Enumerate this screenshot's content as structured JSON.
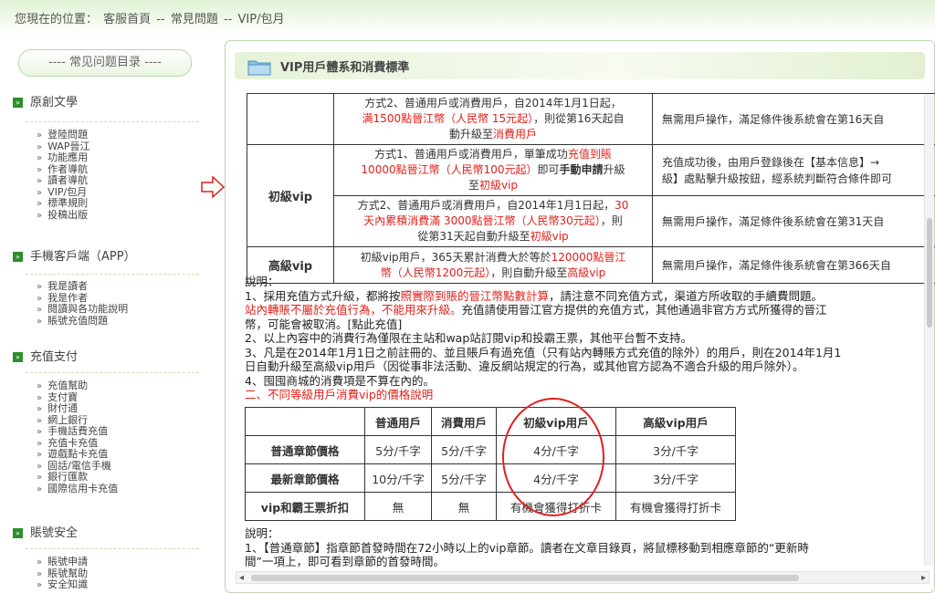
{
  "breadcrumb": {
    "prefix": "您現在的位置：",
    "home": "客服首頁",
    "sep": "--",
    "faq": "常見問題",
    "current": "VIP/包月"
  },
  "sidebar": {
    "title": "---- 常见问题目录 ----",
    "categories": [
      {
        "name": "原創文學",
        "links": [
          "登陸問題",
          "WAP晉江",
          "功能應用",
          "作者導航",
          "讀者導航",
          "VIP/包月",
          "標準規則",
          "投稿出版"
        ]
      },
      {
        "name": "手機客戶端（APP）",
        "links": [
          "我是讀者",
          "我是作者",
          "閱讀與各功能說明",
          "賬號充值問題"
        ]
      },
      {
        "name": "充值支付",
        "links": [
          "充值幫助",
          "支付寶",
          "財付通",
          "網上銀行",
          "手機話費充值",
          "充值卡充值",
          "遊戲點卡充值",
          "固話/電信手機",
          "銀行匯款",
          "國際信用卡充值"
        ]
      },
      {
        "name": "賬號安全",
        "links": [
          "賬號申請",
          "賬號幫助",
          "安全知識"
        ]
      }
    ]
  },
  "panel": {
    "title": "VIP用戶體系和消費標準"
  },
  "vip_table": {
    "row0": {
      "a": "方式2、普通用戶或消費用戶，自2014年1月1日起，",
      "b": "满1500點晉江幣（人民幣 15元起）",
      "c": "，則從第16天起自",
      "d": "動升級至",
      "e": "消費用戶",
      "right": "無需用戶操作，滿足條件後系統會在第16天自"
    },
    "row1": {
      "level": "初級vip",
      "a": "方式1、普通用戶或消費用戶，單筆成功",
      "b": "充值到賬",
      "c": "10000點晉江幣（人民幣100元起）",
      "d": "即可",
      "e": "手動申請",
      "f": "升級",
      "g": "至",
      "h": "初級vip",
      "right1": "充值成功後，由用戶登錄後在【基本信息】→",
      "right2": "級】處點擊升級按鈕，經系統判斷符合條件即可"
    },
    "row2": {
      "a": "方式2、普通用戶或消費用戶，自2014年1月1日起，",
      "b": "30",
      "c": "天內累積消費滿 3000點晉江幣（人民幣30元起）",
      "d": "，則",
      "e": "從第31天起自動升級至",
      "f": "初級vip",
      "right": "無需用戶操作，滿足條件後系統會在第31天自"
    },
    "row3": {
      "level": "高級vip",
      "a": "初級vip用戶，365天累計消費大於等於",
      "b": "120000點晉江",
      "c": "幣（人民幣1200元起）",
      "d": "，則自動升級至",
      "e": "高級vip",
      "right": "無需用戶操作，滿足條件後系統會在第366天自"
    }
  },
  "notes1": {
    "title": "說明：",
    "l1a": "1、採用充值方式升級，都將按",
    "l1b": "照實際到賬的晉江幣點數計算",
    "l1c": "，請注意不同充值方式，渠道方所收取的手續費問題。",
    "l2a": "站內轉賬不屬於充值行為，不能用來升級。",
    "l2b": "充值請使用晉江官方提供的充值方式，其他通過非官方方式所獲得的晉江",
    "l3a": "幣，可能會被取消。[",
    "l3b": "點此充值",
    "l3c": "]",
    "l4": "2、以上內容中的消費行為僅限在主站和wap站訂閱vip和投霸王票，其他平台暫不支持。",
    "l5": "3、凡是在2014年1月1日之前註冊的、並且賬戶有過充值（只有站內轉賬方式充值的除外）的用戶，則在2014年1月1",
    "l6": "日自動升級至高級vip用戶（因從事非法活動、違反網站規定的行為，或其他官方認為不適合升級的用戶除外）。",
    "l7": "4、囤囤商城的消費項是不算在內的。",
    "l8": "二、不同等級用戶消費vip的價格說明"
  },
  "price_table": {
    "headers": [
      "",
      "普通用戶",
      "消費用戶",
      "初級vip用戶",
      "高級vip用戶"
    ],
    "rows": [
      [
        "普通章節價格",
        "5分/千字",
        "5分/千字",
        "4分/千字",
        "3分/千字"
      ],
      [
        "最新章節價格",
        "10分/千字",
        "5分/千字",
        "4分/千字",
        "3分/千字"
      ],
      [
        "vip和霸王票折扣",
        "無",
        "無",
        "有機會獲得打折卡",
        "有機會獲得打折卡"
      ]
    ]
  },
  "notes2": {
    "title": "說明：",
    "l1": "1、【普通章節】指章節首發時間在72小時以上的vip章節。讀者在文章目錄頁，將鼠標移動到相應章節的“更新時",
    "l2": "間”一項上，即可看到章節的首發時間。"
  }
}
